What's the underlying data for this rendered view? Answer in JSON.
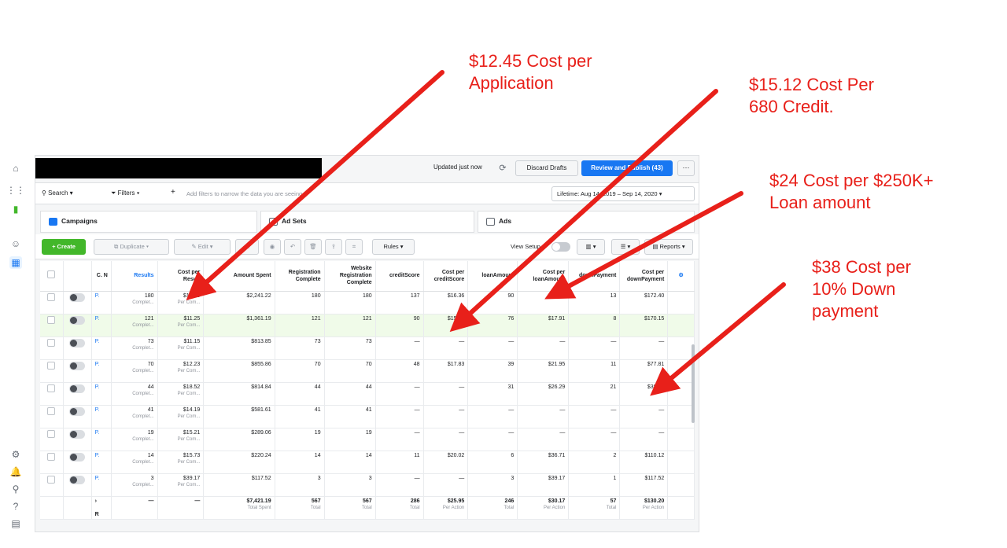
{
  "annotations": [
    {
      "id": "a1",
      "lines": [
        "$12.45 Cost per",
        "Application"
      ]
    },
    {
      "id": "a2",
      "lines": [
        "$15.12 Cost Per",
        "680 Credit."
      ]
    },
    {
      "id": "a3",
      "lines": [
        "$24 Cost per $250K+",
        "Loan amount"
      ]
    },
    {
      "id": "a4",
      "lines": [
        "$38 Cost per",
        "10% Down",
        "payment"
      ]
    }
  ],
  "topbar": {
    "updated": "Updated just now",
    "discard": "Discard Drafts",
    "review": "Review and Publish (43)",
    "more": "⋯"
  },
  "searchbar": {
    "search": "Search",
    "filters": "Filters",
    "add": "+",
    "hint": "Add filters to narrow the data you are seeing.",
    "lifetime": "Lifetime: Aug 14, 2019 – Sep 14, 2020"
  },
  "tabs": {
    "campaigns": "Campaigns",
    "adsets": "Ad Sets",
    "ads": "Ads"
  },
  "toolbar": {
    "create": "+ Create",
    "duplicate": "Duplicate",
    "edit": "Edit",
    "rules": "Rules",
    "view_setup": "View Setup",
    "reports": "Reports"
  },
  "columns": [
    "",
    "",
    "C. N",
    "Results",
    "Cost per Result",
    "Amount Spent",
    "Registration Complete",
    "Website Registration Complete",
    "creditScore",
    "Cost per creditScore",
    "loanAmount",
    "Cost per loanAmount",
    "downPayment",
    "Cost per downPayment",
    ""
  ],
  "rows": [
    {
      "name": "P.",
      "results": "180",
      "cpr": "$12.45",
      "spent": "$2,241.22",
      "reg": "180",
      "web": "180",
      "cs": "137",
      "ccs": "$16.36",
      "la": "90",
      "cla": "$24.90",
      "dp": "13",
      "cdp": "$172.40"
    },
    {
      "name": "P.",
      "results": "121",
      "cpr": "$11.25",
      "spent": "$1,361.19",
      "reg": "121",
      "web": "121",
      "cs": "90",
      "ccs": "$15.12",
      "la": "76",
      "cla": "$17.91",
      "dp": "8",
      "cdp": "$170.15"
    },
    {
      "name": "P.",
      "results": "73",
      "cpr": "$11.15",
      "spent": "$813.85",
      "reg": "73",
      "web": "73",
      "cs": "—",
      "ccs": "—",
      "la": "—",
      "cla": "—",
      "dp": "—",
      "cdp": "—"
    },
    {
      "name": "P.",
      "results": "70",
      "cpr": "$12.23",
      "spent": "$855.86",
      "reg": "70",
      "web": "70",
      "cs": "48",
      "ccs": "$17.83",
      "la": "39",
      "cla": "$21.95",
      "dp": "11",
      "cdp": "$77.81"
    },
    {
      "name": "P.",
      "results": "44",
      "cpr": "$18.52",
      "spent": "$814.84",
      "reg": "44",
      "web": "44",
      "cs": "—",
      "ccs": "—",
      "la": "31",
      "cla": "$26.29",
      "dp": "21",
      "cdp": "$38.80"
    },
    {
      "name": "P.",
      "results": "41",
      "cpr": "$14.19",
      "spent": "$581.61",
      "reg": "41",
      "web": "41",
      "cs": "—",
      "ccs": "—",
      "la": "—",
      "cla": "—",
      "dp": "—",
      "cdp": "—"
    },
    {
      "name": "P.",
      "results": "19",
      "cpr": "$15.21",
      "spent": "$289.06",
      "reg": "19",
      "web": "19",
      "cs": "—",
      "ccs": "—",
      "la": "—",
      "cla": "—",
      "dp": "—",
      "cdp": "—"
    },
    {
      "name": "P.",
      "results": "14",
      "cpr": "$15.73",
      "spent": "$220.24",
      "reg": "14",
      "web": "14",
      "cs": "11",
      "ccs": "$20.02",
      "la": "6",
      "cla": "$36.71",
      "dp": "2",
      "cdp": "$110.12"
    },
    {
      "name": "P.",
      "results": "3",
      "cpr": "$39.17",
      "spent": "$117.52",
      "reg": "3",
      "web": "3",
      "cs": "—",
      "ccs": "—",
      "la": "3",
      "cla": "$39.17",
      "dp": "1",
      "cdp": "$117.52"
    }
  ],
  "row_sub": {
    "results": "Complet...",
    "cpr": "Per Com..."
  },
  "totals": {
    "name": "›",
    "r": "R",
    "results": "—",
    "cpr": "—",
    "spent": "$7,421.19",
    "spent_sub": "Total Spent",
    "reg": "567",
    "reg_sub": "Total",
    "web": "567",
    "web_sub": "Total",
    "cs": "286",
    "cs_sub": "Total",
    "ccs": "$25.95",
    "ccs_sub": "Per Action",
    "la": "246",
    "la_sub": "Total",
    "cla": "$30.17",
    "cla_sub": "Per Action",
    "dp": "57",
    "dp_sub": "Total",
    "cdp": "$130.20",
    "cdp_sub": "Per Action"
  }
}
